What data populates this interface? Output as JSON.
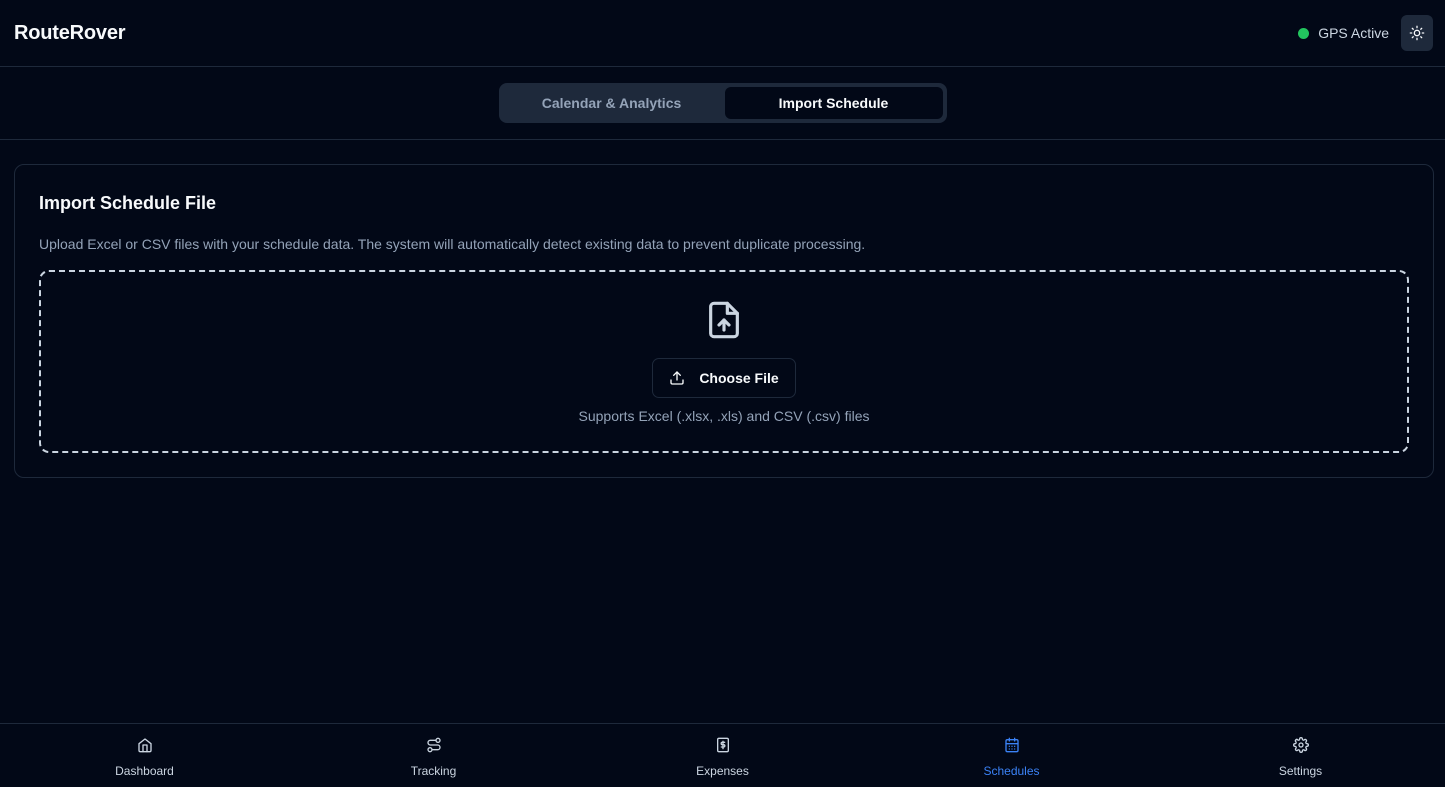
{
  "header": {
    "app_title": "RouteRover",
    "gps_status": "GPS Active",
    "gps_color": "#22c55e",
    "theme_icon": "sun-icon"
  },
  "tabs": [
    {
      "label": "Calendar & Analytics",
      "active": false
    },
    {
      "label": "Import Schedule",
      "active": true
    }
  ],
  "import_card": {
    "title": "Import Schedule File",
    "description": "Upload Excel or CSV files with your schedule data. The system will automatically detect existing data to prevent duplicate processing.",
    "dropzone_icon": "file-upload-icon",
    "choose_button_label": "Choose File",
    "choose_button_icon": "upload-icon",
    "supported_formats": "Supports Excel (.xlsx, .xls) and CSV (.csv) files"
  },
  "bottom_nav": {
    "items": [
      {
        "label": "Dashboard",
        "icon": "home-icon",
        "active": false
      },
      {
        "label": "Tracking",
        "icon": "route-icon",
        "active": false
      },
      {
        "label": "Expenses",
        "icon": "receipt-dollar-icon",
        "active": false
      },
      {
        "label": "Schedules",
        "icon": "calendar-icon",
        "active": true
      },
      {
        "label": "Settings",
        "icon": "gear-icon",
        "active": false
      }
    ],
    "active_color": "#3b82f6"
  }
}
